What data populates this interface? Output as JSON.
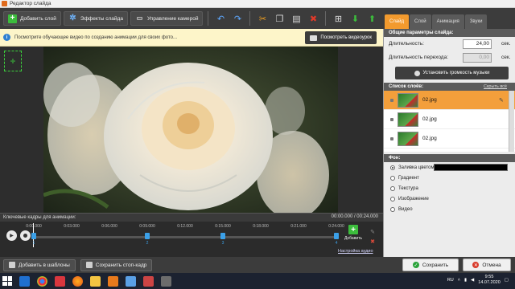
{
  "window": {
    "title": "Редактор слайда"
  },
  "toolbar": {
    "add_layer": "Добавить слой",
    "slide_effects": "Эффекты слайда",
    "camera": "Управление камерой"
  },
  "right_tabs": [
    {
      "label": "Слайд",
      "active": true
    },
    {
      "label": "Слой",
      "active": false
    },
    {
      "label": "Анимация",
      "active": false
    },
    {
      "label": "Звуки",
      "active": false
    }
  ],
  "infobar": {
    "text": "Посмотрите обучающее видео по созданию анимации для своих фото...",
    "watch_button": "Посмотреть видеоурок"
  },
  "keyframes": {
    "title": "Ключевые кадры для анимации:",
    "time": "00:00.000 / 00:24.000",
    "ticks": [
      "0:00.000",
      "0:03.000",
      "0:06.000",
      "0:09.000",
      "0:12.000",
      "0:15.000",
      "0:18.000",
      "0:21.000",
      "0:24.000"
    ],
    "markers": [
      {
        "label": "1",
        "pos": 0.0
      },
      {
        "label": "2",
        "pos": 0.375
      },
      {
        "label": "3",
        "pos": 0.625
      },
      {
        "label": "4",
        "pos": 1.0
      }
    ],
    "add_label": "Добавить",
    "speed_link": "Настройка аудио"
  },
  "general": {
    "header": "Общие параметры слайда:",
    "duration_label": "Длительность:",
    "duration_value": "24,00",
    "duration_unit": "сек.",
    "transition_label": "Длительность перехода:",
    "transition_value": "0,00",
    "transition_unit": "сек.",
    "music_button": "Установить громкость музыки"
  },
  "slides": {
    "header": "Список слоёв:",
    "hide_link": "Скрыть всё",
    "items": [
      {
        "name": "02.jpg",
        "selected": true
      },
      {
        "name": "02.jpg",
        "selected": false
      },
      {
        "name": "02.jpg",
        "selected": false
      }
    ]
  },
  "background": {
    "header": "Фон:",
    "options": [
      {
        "label": "Заливка цветом",
        "checked": true
      },
      {
        "label": "Градиент",
        "checked": false
      },
      {
        "label": "Текстура",
        "checked": false
      },
      {
        "label": "Изображение",
        "checked": false
      },
      {
        "label": "Видео",
        "checked": false
      }
    ],
    "fill_color": "#000000"
  },
  "bottom": {
    "add_template": "Добавить в шаблоны",
    "save_frame": "Сохранить стоп-кадр",
    "save": "Сохранить",
    "cancel": "Отмена"
  },
  "taskbar": {
    "lang": "RU",
    "time": "9:55",
    "date": "14.07.2020"
  },
  "colors": {
    "accent": "#f29a2e",
    "toolbar": "#3c3c3c",
    "keyframe": "#3ba0e8"
  }
}
